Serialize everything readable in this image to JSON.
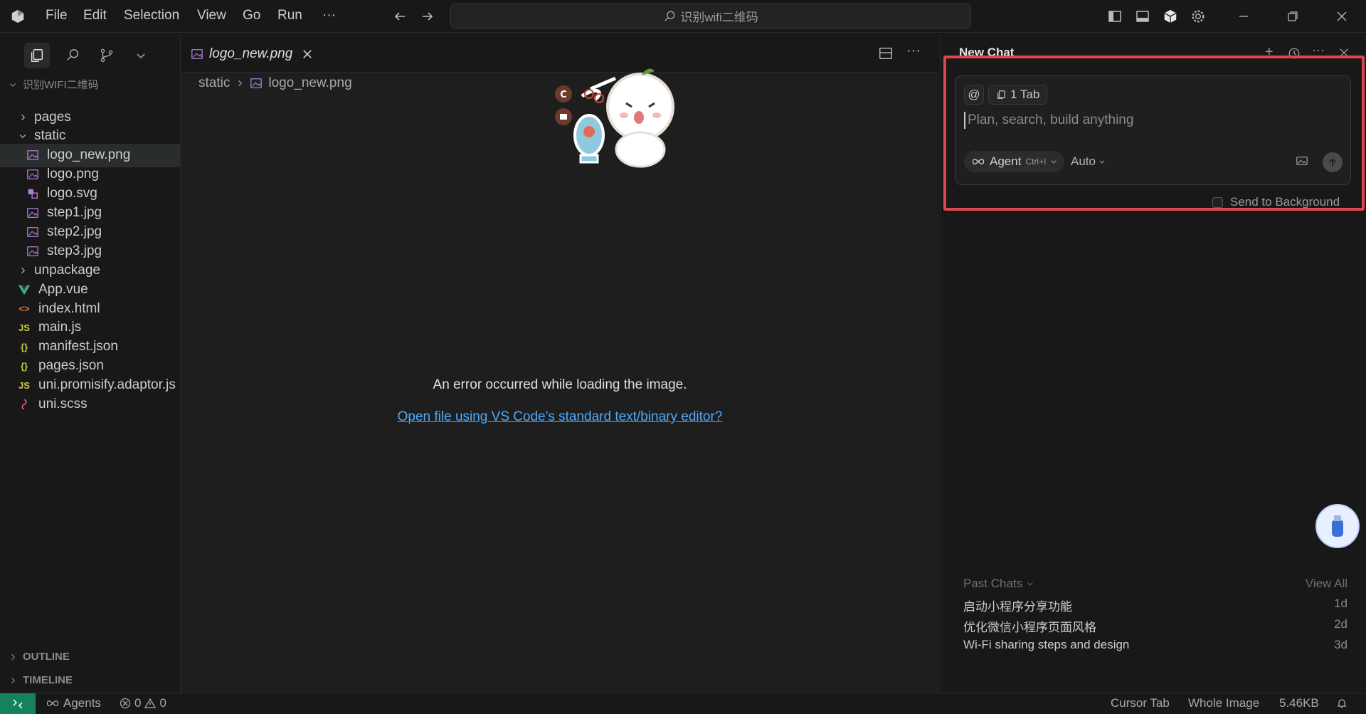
{
  "titlebar": {
    "menus": [
      "File",
      "Edit",
      "Selection",
      "View",
      "Go",
      "Run",
      "···"
    ],
    "search_text": "识别wifi二维码"
  },
  "sidebar": {
    "explorer_title": "识别WIFI二维码",
    "tree": [
      {
        "label": "pages",
        "kind": "folder-closed",
        "indent": 0
      },
      {
        "label": "static",
        "kind": "folder-open",
        "indent": 0
      },
      {
        "label": "logo_new.png",
        "kind": "image",
        "indent": 1,
        "selected": true
      },
      {
        "label": "logo.png",
        "kind": "image",
        "indent": 1
      },
      {
        "label": "logo.svg",
        "kind": "svg",
        "indent": 1
      },
      {
        "label": "step1.jpg",
        "kind": "image",
        "indent": 1
      },
      {
        "label": "step2.jpg",
        "kind": "image",
        "indent": 1
      },
      {
        "label": "step3.jpg",
        "kind": "image",
        "indent": 1
      },
      {
        "label": "unpackage",
        "kind": "folder-closed",
        "indent": 0
      },
      {
        "label": "App.vue",
        "kind": "vue",
        "indent": 0
      },
      {
        "label": "index.html",
        "kind": "html",
        "indent": 0
      },
      {
        "label": "main.js",
        "kind": "js",
        "indent": 0
      },
      {
        "label": "manifest.json",
        "kind": "json",
        "indent": 0
      },
      {
        "label": "pages.json",
        "kind": "json",
        "indent": 0
      },
      {
        "label": "uni.promisify.adaptor.js",
        "kind": "js",
        "indent": 0
      },
      {
        "label": "uni.scss",
        "kind": "scss",
        "indent": 0
      }
    ],
    "outline_label": "OUTLINE",
    "timeline_label": "TIMELINE"
  },
  "editor": {
    "tab_label": "logo_new.png",
    "breadcrumb_folder": "static",
    "breadcrumb_file": "logo_new.png",
    "error_message": "An error occurred while loading the image.",
    "open_link": "Open file using VS Code's standard text/binary editor?"
  },
  "chat": {
    "title": "New Chat",
    "tab_chip": "1 Tab",
    "input_placeholder": "Plan, search, build anything",
    "agent_label": "Agent",
    "agent_shortcut": "Ctrl+I",
    "model_label": "Auto",
    "send_to_background": "Send to Background",
    "past_chats_label": "Past Chats",
    "view_all_label": "View All",
    "past_chats": [
      {
        "title": "启动小程序分享功能",
        "age": "1d"
      },
      {
        "title": "优化微信小程序页面风格",
        "age": "2d"
      },
      {
        "title": "Wi-Fi sharing steps and design",
        "age": "3d"
      }
    ]
  },
  "statusbar": {
    "agents_label": "Agents",
    "errors": "0",
    "warnings": "0",
    "cursor_tab": "Cursor Tab",
    "whole_image": "Whole Image",
    "file_size": "5.46KB"
  },
  "colors": {
    "accent_highlight": "#e0454f",
    "link": "#4daafc",
    "remote": "#16825d"
  }
}
